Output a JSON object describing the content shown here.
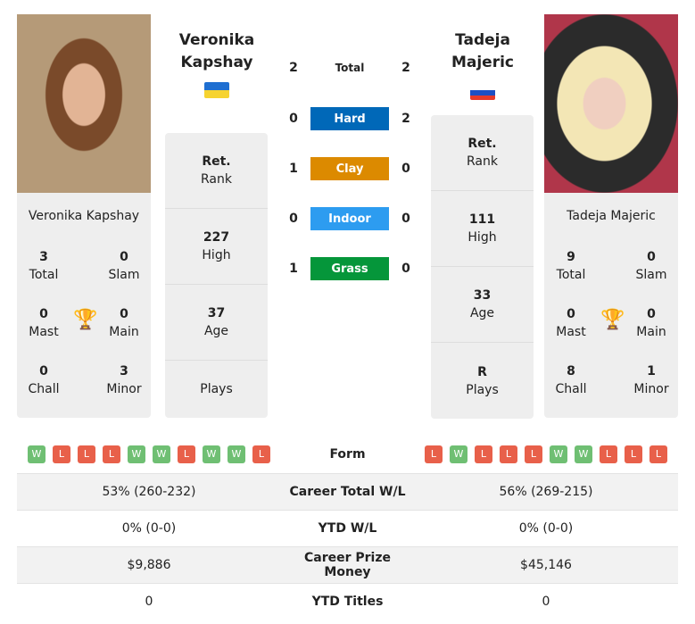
{
  "player1": {
    "name": "Veronika Kapshay",
    "name_line1": "Veronika",
    "name_line2": "Kapshay",
    "flag": "ukraine",
    "titles": {
      "total": "3",
      "slam": "0",
      "mast": "0",
      "main": "0",
      "chall": "0",
      "minor": "3"
    },
    "rank": "Ret.",
    "high": "227",
    "age": "37",
    "plays": "",
    "form": [
      "W",
      "L",
      "L",
      "L",
      "W",
      "W",
      "L",
      "W",
      "W",
      "L"
    ],
    "career_wl": "53% (260-232)",
    "ytd_wl": "0% (0-0)",
    "prize": "$9,886",
    "ytd_titles": "0"
  },
  "player2": {
    "name": "Tadeja Majeric",
    "name_line1": "Tadeja",
    "name_line2": "Majeric",
    "flag": "slovenia",
    "titles": {
      "total": "9",
      "slam": "0",
      "mast": "0",
      "main": "0",
      "chall": "8",
      "minor": "1"
    },
    "rank": "Ret.",
    "high": "111",
    "age": "33",
    "plays": "R",
    "form": [
      "L",
      "W",
      "L",
      "L",
      "L",
      "W",
      "W",
      "L",
      "L",
      "L"
    ],
    "career_wl": "56% (269-215)",
    "ytd_wl": "0% (0-0)",
    "prize": "$45,146",
    "ytd_titles": "0"
  },
  "labels": {
    "total": "Total",
    "slam": "Slam",
    "mast": "Mast",
    "main": "Main",
    "chall": "Chall",
    "minor": "Minor",
    "rank": "Rank",
    "high": "High",
    "age": "Age",
    "plays": "Plays",
    "form": "Form",
    "career_wl": "Career Total W/L",
    "ytd_wl": "YTD W/L",
    "prize": "Career Prize Money",
    "ytd_titles": "YTD Titles"
  },
  "h2h": [
    {
      "label": "Total",
      "p1": "2",
      "p2": "2",
      "color": ""
    },
    {
      "label": "Hard",
      "p1": "0",
      "p2": "2",
      "color": "#0068b8"
    },
    {
      "label": "Clay",
      "p1": "1",
      "p2": "0",
      "color": "#dc8a00"
    },
    {
      "label": "Indoor",
      "p1": "0",
      "p2": "0",
      "color": "#2d9cf0"
    },
    {
      "label": "Grass",
      "p1": "1",
      "p2": "0",
      "color": "#05963a"
    }
  ]
}
